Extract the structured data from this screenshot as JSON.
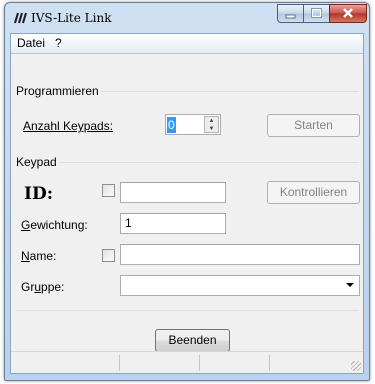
{
  "window": {
    "title": "IVS-Lite Link"
  },
  "menu": {
    "items": [
      "Datei",
      "?"
    ]
  },
  "programmieren": {
    "section_label": "Programmieren",
    "anzahl_label": "Anzahl Keypads:",
    "anzahl_value": "0",
    "starten_label": "Starten"
  },
  "keypad": {
    "section_label": "Keypad",
    "id_label": "ID:",
    "id_value": "",
    "kontrollieren_label": "Kontrollieren",
    "gewichtung_label": "Gewichtung:",
    "gewichtung_value": "1",
    "name_label": "Name:",
    "name_value": "",
    "gruppe_label": "Gruppe:",
    "gruppe_value": ""
  },
  "footer": {
    "beenden_label": "Beenden"
  }
}
